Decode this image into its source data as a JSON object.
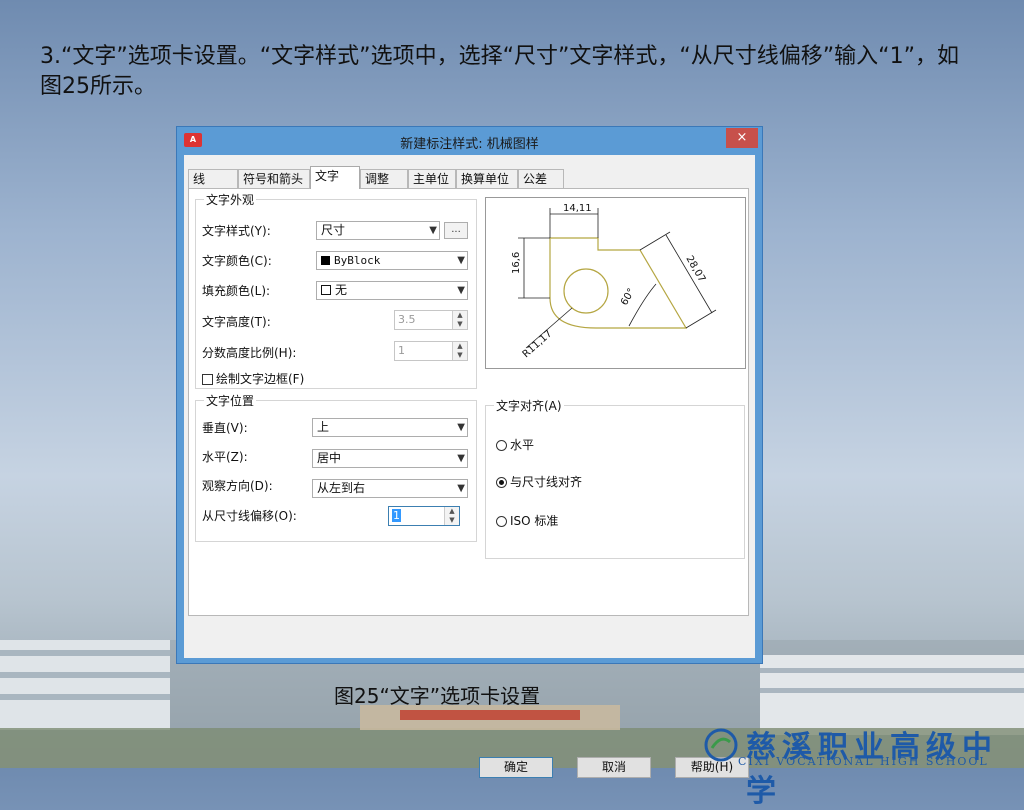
{
  "slide": {
    "caption_top": "3.“文字”选项卡设置。“文字样式”选项中，选择“尺寸”文字样式，“从尺寸线偏移”输入“1”，如图25所示。",
    "caption_bottom": "图25“文字”选项卡设置",
    "school_cn": "慈溪职业高级中学",
    "school_en": "CIXI VOCATIONAL HIGH SCHOOL",
    "school_color": "#1e5aa8"
  },
  "dialog": {
    "app_icon_text": "A",
    "title": "新建标注样式: 机械图样",
    "close": "×",
    "tabs": [
      "线",
      "符号和箭头",
      "文字",
      "调整",
      "主单位",
      "换算单位",
      "公差"
    ],
    "active_tab": "文字",
    "appearance": {
      "group_title": "文字外观",
      "style_label": "文字样式(Y):",
      "style_value": "尺寸",
      "style_more": "...",
      "color_label": "文字颜色(C):",
      "color_value": "ByBlock",
      "fill_label": "填充颜色(L):",
      "fill_value": "无",
      "height_label": "文字高度(T):",
      "height_value": "3.5",
      "fraction_label": "分数高度比例(H):",
      "fraction_value": "1",
      "frame_label": "绘制文字边框(F)"
    },
    "placement": {
      "group_title": "文字位置",
      "vertical_label": "垂直(V):",
      "vertical_value": "上",
      "horizontal_label": "水平(Z):",
      "horizontal_value": "居中",
      "direction_label": "观察方向(D):",
      "direction_value": "从左到右",
      "offset_label": "从尺寸线偏移(O):",
      "offset_value": "1"
    },
    "alignment": {
      "group_title": "文字对齐(A)",
      "options": [
        "水平",
        "与尺寸线对齐",
        "ISO 标准"
      ],
      "selected": "与尺寸线对齐"
    },
    "preview": {
      "dim_top": "14,11",
      "dim_left": "16,6",
      "dim_right": "28,07",
      "dim_angle": "60°",
      "dim_radius": "R11,17"
    },
    "buttons": {
      "ok": "确定",
      "cancel": "取消",
      "help": "帮助(H)"
    }
  }
}
